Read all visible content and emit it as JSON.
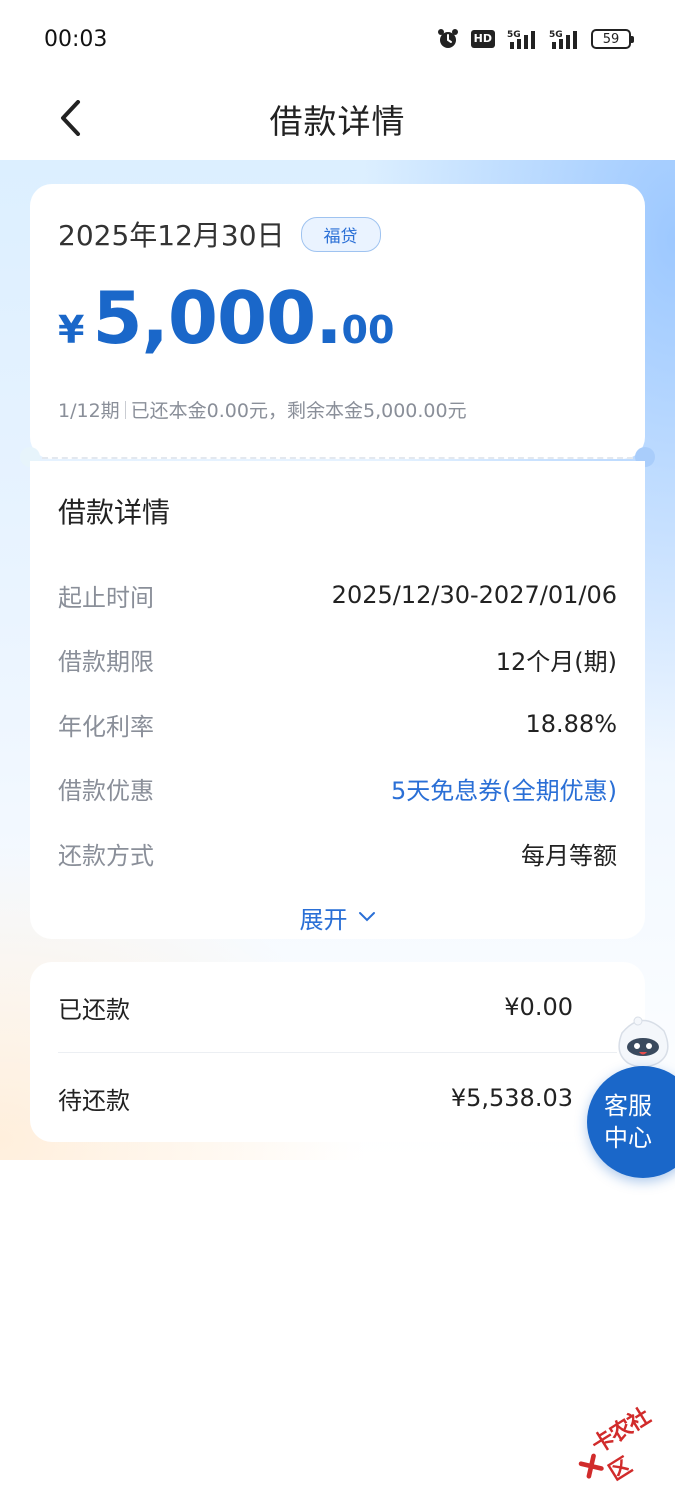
{
  "status_bar": {
    "time": "00:03",
    "hd_label": "HD",
    "signal_1": "5G",
    "signal_2": "5G",
    "battery": "59"
  },
  "nav": {
    "title": "借款详情",
    "back_icon": "chevron-left-icon"
  },
  "summary": {
    "date": "2025年12月30日",
    "tag": "福贷",
    "currency": "¥",
    "amount_int": "5,000.",
    "amount_dec": "00",
    "period": "1/12期",
    "repaid_info": "已还本金0.00元，剩余本金5,000.00元"
  },
  "details": {
    "title": "借款详情",
    "rows": [
      {
        "label": "起止时间",
        "value": "2025/12/30-2027/01/06"
      },
      {
        "label": "借款期限",
        "value": "12个月(期)"
      },
      {
        "label": "年化利率",
        "value": "18.88%"
      },
      {
        "label": "借款优惠",
        "value": "5天免息券(全期优惠)"
      },
      {
        "label": "还款方式",
        "value": "每月等额"
      }
    ],
    "expand_label": "展开"
  },
  "repayment": {
    "repaid_label": "已还款",
    "repaid_value": "¥0.00",
    "pending_label": "待还款",
    "pending_value": "¥5,538.03"
  },
  "customer_service": {
    "line1": "客服",
    "line2": "中心"
  },
  "watermark": {
    "text": "卡农社区"
  },
  "colors": {
    "accent": "#1a67c9",
    "link": "#2a6fd6",
    "label_gray": "#8a8f99"
  }
}
